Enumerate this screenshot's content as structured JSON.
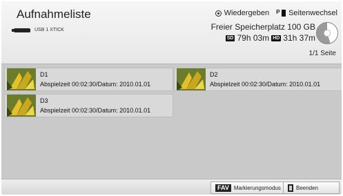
{
  "header": {
    "title": "Aufnahmeliste",
    "device": "USB 1 XTICK",
    "legend": {
      "play_icon": "record-dot-icon",
      "play_label": "Wiedergeben",
      "page_icon": "p-page-icon",
      "page_label": "Seitenwechsel"
    },
    "storage": {
      "free_label": "Freier Speicherplatz 100 GB",
      "sd_badge": "SD",
      "sd_time": "79h 03m",
      "hd_badge": "HD",
      "hd_time": "31h 37m"
    },
    "page_indicator": "1/1 Seite"
  },
  "items": [
    {
      "name": "D1",
      "meta": "Abspielzeit 00:02:30/Datum: 2010.01.01"
    },
    {
      "name": "D2",
      "meta": "Abspielzeit 00:02:30/Datum: 2010.01.01"
    },
    {
      "name": "D3",
      "meta": "Abspielzeit 00:02:30/Datum: 2010.01.01"
    }
  ],
  "footer": {
    "fav_badge": "FAV",
    "mark_label": "Markierungsmodus",
    "exit_label": "Beenden"
  },
  "colors": {
    "background": "#c9c9c9",
    "header": "#eeeeee",
    "card": "#d9d9d9"
  }
}
